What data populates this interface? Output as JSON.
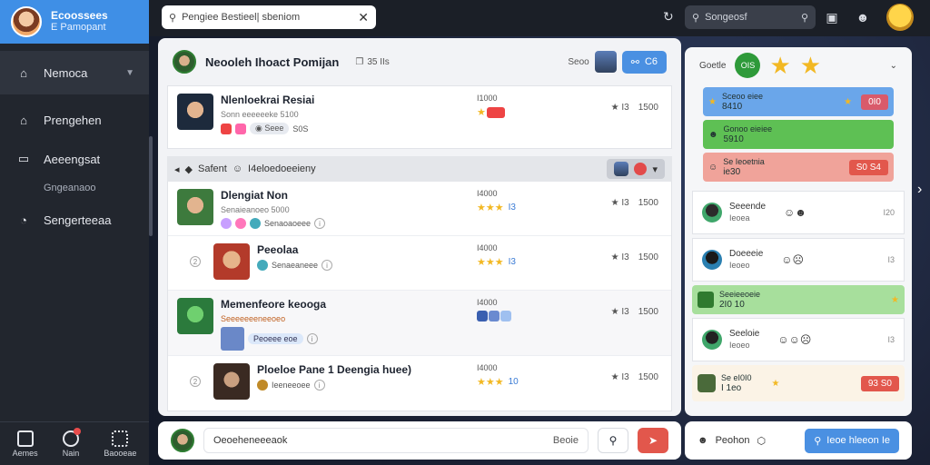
{
  "brand": {
    "title": "Ecoossees",
    "subtitle": "E Pamopant"
  },
  "sidebar": {
    "items": [
      {
        "label": "Nemoca",
        "icon": "home-icon"
      },
      {
        "label": "Prengehen",
        "icon": "home-outline-icon"
      },
      {
        "label": "Aeeengsat",
        "sub": "Gngeanaoo",
        "icon": "chat-icon"
      },
      {
        "label": "Sengerteeaa",
        "icon": "chat-bubble-icon"
      }
    ],
    "bottom": [
      {
        "label": "Aemes",
        "icon": "grid-icon"
      },
      {
        "label": "Nain",
        "icon": "notification-icon"
      },
      {
        "label": "Baooeae",
        "icon": "puzzle-icon"
      }
    ]
  },
  "topbar": {
    "search_placeholder": "Pengiee Bestieel| sbeniom",
    "search2_placeholder": "Songeosf"
  },
  "main": {
    "title": "Neooleh Ihoact Pomijan",
    "meta": "35 IIs",
    "hdr_label": "Seoo",
    "hdr_btn": "C6",
    "rows": [
      {
        "title": "Nlenloekrai Resiai",
        "sub": "Sonn eeeeeeke 5100",
        "tags": "S0S",
        "mid_top": "I1000",
        "mid_val": "",
        "right_a": "I3",
        "right_b": "1500"
      },
      {
        "title": "Dlengiat Non",
        "sub": "Senaieanoeo 5000",
        "tags": "Senaoaoeee",
        "mid_top": "I4000",
        "mid_val": "I3",
        "right_a": "I3",
        "right_b": "1500"
      },
      {
        "title": "Peeolaa",
        "sub": "",
        "tags": "Senaeaneee",
        "mid_top": "I4000",
        "mid_val": "I3",
        "right_a": "I3",
        "right_b": "1500"
      },
      {
        "title": "Memenfeore keooga",
        "sub": "Seeeeeeeneeoeo",
        "tags": "Peoeee eoe",
        "mid_top": "I4000",
        "mid_val": "",
        "right_a": "I3",
        "right_b": "1500"
      },
      {
        "title": "Ploeloe Pane 1 Deengia huee)",
        "sub": "",
        "tags": "Ieeneeoee",
        "mid_top": "I4000",
        "mid_val": "10",
        "right_a": "I3",
        "right_b": "1500"
      }
    ],
    "section": {
      "label": "Safent",
      "sub": "I4eloedoeeieny"
    }
  },
  "bottombar": {
    "comment_placeholder": "Oeoeheneeeaok",
    "comment_right": "Beoie"
  },
  "right": {
    "header_label": "Goetle",
    "green_badge": "OIS",
    "strips": [
      {
        "a": "Sceoo eiee",
        "b": "8410",
        "chip": "0I0"
      },
      {
        "a": "Gonoo eieiee",
        "b": "5910",
        "chip": ""
      },
      {
        "a": "Se Ieoetnia",
        "b": "ie30",
        "chip": "S0 S4"
      },
      {
        "a": "Seeieeoeie",
        "b": "2I0 10",
        "chip": ""
      },
      {
        "a": "Se eI0I0",
        "b": "I 1eo",
        "chip": "93 S0"
      }
    ],
    "users": [
      {
        "name": "Seeende",
        "sub": "Ieoea",
        "num": "I20"
      },
      {
        "name": "Doeeeie",
        "sub": "Ieoeo",
        "num": "I3"
      },
      {
        "name": "Seeloie",
        "sub": "Ieoeo",
        "num": "I3"
      }
    ]
  },
  "right_bottom": {
    "label": "Peohon",
    "cta": "Ieoe hleeon Ie"
  }
}
